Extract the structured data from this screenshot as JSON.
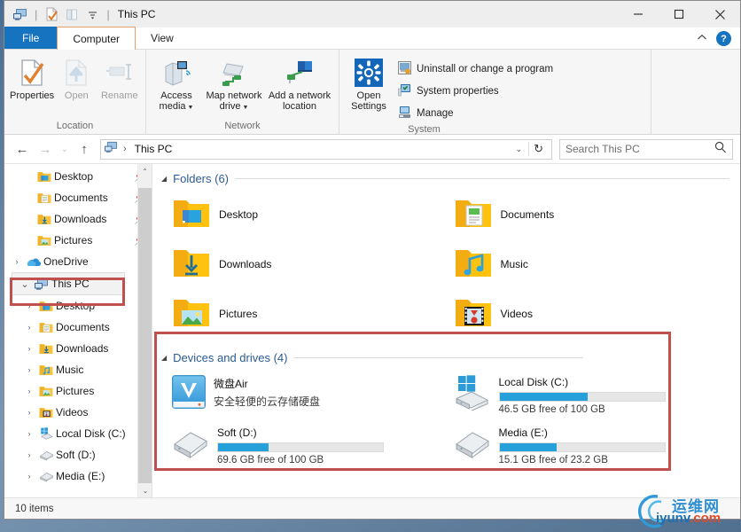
{
  "window": {
    "title": "This PC",
    "quick_access": [
      "explorer-icon",
      "properties-icon",
      "new-folder-icon",
      "dropdown-icon"
    ],
    "controls": {
      "minimize": "—",
      "maximize": "□",
      "close": "✕"
    }
  },
  "tabs": [
    {
      "label": "File",
      "state": "file"
    },
    {
      "label": "Computer",
      "state": "active"
    },
    {
      "label": "View",
      "state": "normal"
    }
  ],
  "tab_right": {
    "collapse": "⌃",
    "help": "?"
  },
  "ribbon": {
    "groups": [
      {
        "label": "Location",
        "buttons": [
          {
            "label": "Properties",
            "icon": "properties-icon",
            "disabled": false
          },
          {
            "label": "Open",
            "icon": "open-icon",
            "disabled": true
          },
          {
            "label": "Rename",
            "icon": "rename-icon",
            "disabled": true
          }
        ]
      },
      {
        "label": "Network",
        "buttons": [
          {
            "label": "Access media",
            "icon": "access-media-icon",
            "caret": true
          },
          {
            "label": "Map network drive",
            "icon": "map-drive-icon",
            "caret": true
          },
          {
            "label": "Add a network location",
            "icon": "add-network-icon",
            "caret": false
          }
        ]
      },
      {
        "label": "System",
        "big": {
          "label": "Open Settings",
          "icon": "settings-gear-icon"
        },
        "small": [
          {
            "label": "Uninstall or change a program",
            "icon": "uninstall-icon"
          },
          {
            "label": "System properties",
            "icon": "system-properties-icon"
          },
          {
            "label": "Manage",
            "icon": "manage-icon"
          }
        ]
      }
    ]
  },
  "address": {
    "back": "←",
    "forward": "→",
    "recent": "⌄",
    "up": "↑",
    "crumb_icon": "this-pc-icon",
    "crumb": "This PC",
    "crumb_sep": "›",
    "dropdown": "⌄",
    "refresh": "↻",
    "search_placeholder": "Search This PC"
  },
  "navpane": {
    "items": [
      {
        "label": "Desktop",
        "icon": "folder-desktop-icon",
        "indent": 2,
        "expander": "",
        "pin": true
      },
      {
        "label": "Documents",
        "icon": "folder-docs-icon",
        "indent": 2,
        "expander": "",
        "pin": true
      },
      {
        "label": "Downloads",
        "icon": "folder-downloads-icon",
        "indent": 2,
        "expander": "",
        "pin": true
      },
      {
        "label": "Pictures",
        "icon": "folder-pictures-icon",
        "indent": 2,
        "expander": "",
        "pin": true
      },
      {
        "label": "OneDrive",
        "icon": "onedrive-icon",
        "indent": 1,
        "expander": "›",
        "pin": false
      },
      {
        "label": "This PC",
        "icon": "this-pc-icon",
        "indent": 1,
        "expander": "⌄",
        "pin": false,
        "selected": true
      },
      {
        "label": "Desktop",
        "icon": "folder-desktop-icon",
        "indent": 2,
        "expander": "›",
        "pin": false
      },
      {
        "label": "Documents",
        "icon": "folder-docs-icon",
        "indent": 2,
        "expander": "›",
        "pin": false
      },
      {
        "label": "Downloads",
        "icon": "folder-downloads-icon",
        "indent": 2,
        "expander": "›",
        "pin": false
      },
      {
        "label": "Music",
        "icon": "folder-music-icon",
        "indent": 2,
        "expander": "›",
        "pin": false
      },
      {
        "label": "Pictures",
        "icon": "folder-pictures-icon",
        "indent": 2,
        "expander": "›",
        "pin": false
      },
      {
        "label": "Videos",
        "icon": "folder-videos-icon",
        "indent": 2,
        "expander": "›",
        "pin": false
      },
      {
        "label": "Local Disk (C:)",
        "icon": "windows-drive-icon",
        "indent": 2,
        "expander": "›",
        "pin": false
      },
      {
        "label": "Soft (D:)",
        "icon": "drive-icon",
        "indent": 2,
        "expander": "›",
        "pin": false
      },
      {
        "label": "Media (E:)",
        "icon": "drive-icon",
        "indent": 2,
        "expander": "›",
        "pin": false
      }
    ],
    "scroll_up": "⌃",
    "scroll_down": "⌄"
  },
  "content": {
    "folders_section": {
      "title": "Folders (6)",
      "triangle": "◢",
      "items": [
        {
          "name": "Desktop",
          "icon": "folder-desktop-icon"
        },
        {
          "name": "Documents",
          "icon": "folder-docs-icon"
        },
        {
          "name": "Downloads",
          "icon": "folder-downloads-icon"
        },
        {
          "name": "Music",
          "icon": "folder-music-icon"
        },
        {
          "name": "Pictures",
          "icon": "folder-pictures-icon"
        },
        {
          "name": "Videos",
          "icon": "folder-videos-icon"
        }
      ]
    },
    "devices_section": {
      "title": "Devices and drives (4)",
      "triangle": "◢",
      "items": [
        {
          "name": "微盘Air",
          "subtitle": "安全轻便的云存储硬盘",
          "icon": "weipan-air-icon",
          "has_bar": false
        },
        {
          "name": "Local Disk (C:)",
          "icon": "windows-drive-icon",
          "has_bar": true,
          "used_percent": 53.5,
          "capacity_text": "46.5 GB free of 100 GB"
        },
        {
          "name": "Soft (D:)",
          "icon": "drive-icon",
          "has_bar": true,
          "used_percent": 30.4,
          "capacity_text": "69.6 GB free of 100 GB"
        },
        {
          "name": "Media (E:)",
          "icon": "drive-icon",
          "has_bar": true,
          "used_percent": 34.9,
          "capacity_text": "15.1 GB free of 23.2 GB"
        }
      ]
    }
  },
  "statusbar": {
    "item_count": "10 items"
  },
  "watermark": {
    "cn": "运维网",
    "en": "iyunv",
    "en_dot": ".com"
  },
  "colors": {
    "accent_blue": "#1673c0",
    "progress_blue": "#26a0da",
    "highlight_red": "#c0504d",
    "section_heading": "#2a5a95",
    "folder_yellow": "#ffc20e"
  }
}
